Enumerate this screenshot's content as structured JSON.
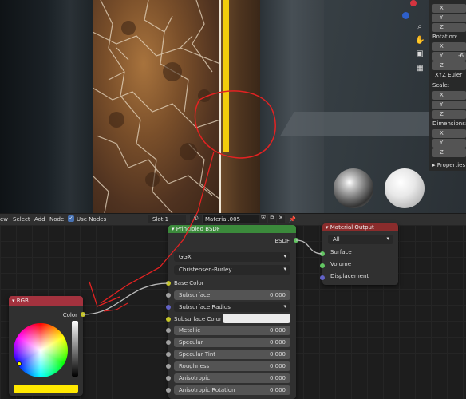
{
  "viewport": {
    "gizmo_icons": [
      "zoom-icon",
      "hand-icon",
      "camera-icon",
      "grid-icon"
    ],
    "n_panel": {
      "location_axes": [
        "X",
        "Y",
        "Z"
      ],
      "rotation_label": "Rotation:",
      "rotation_axes": [
        "X",
        "Y",
        "Z"
      ],
      "rotation_values": [
        "",
        "-6",
        ""
      ],
      "rotation_mode": "XYZ Euler",
      "scale_label": "Scale:",
      "scale_axes": [
        "X",
        "Y",
        "Z"
      ],
      "dimensions_label": "Dimensions:",
      "dimensions_axes": [
        "X",
        "Y",
        "Z"
      ],
      "properties_label": "Properties"
    }
  },
  "header": {
    "menu_partial": "ew",
    "select": "Select",
    "add": "Add",
    "node": "Node",
    "use_nodes": "Use Nodes",
    "slot": "Slot 1",
    "material_name": "Material.005"
  },
  "nodes": {
    "principled": {
      "title": "Principled BSDF",
      "output": "BSDF",
      "distribution": "GGX",
      "subsurface_method": "Christensen-Burley",
      "base_color": "Base Color",
      "fields": [
        {
          "label": "Subsurface",
          "value": "0.000"
        },
        {
          "label": "Subsurface Radius",
          "value": ""
        },
        {
          "label": "Subsurface Color",
          "value": ""
        },
        {
          "label": "Metallic",
          "value": "0.000"
        },
        {
          "label": "Specular",
          "value": "0.000"
        },
        {
          "label": "Specular Tint",
          "value": "0.000"
        },
        {
          "label": "Roughness",
          "value": "0.000"
        },
        {
          "label": "Anisotropic",
          "value": "0.000"
        },
        {
          "label": "Anisotropic Rotation",
          "value": "0.000"
        }
      ]
    },
    "material_output": {
      "title": "Material Output",
      "target": "All",
      "inputs": [
        "Surface",
        "Volume",
        "Displacement"
      ]
    },
    "rgb": {
      "title": "RGB",
      "output": "Color",
      "swatch_color": "#ffe800"
    }
  },
  "colors": {
    "shader_header": "#3b8a3b",
    "output_header": "#8a2c2c",
    "input_header": "#a3323e",
    "socket_shader": "#63c763",
    "socket_color": "#c7c729",
    "socket_float": "#a1a1a1",
    "socket_vector": "#6363c7",
    "annotation": "#e32222"
  }
}
